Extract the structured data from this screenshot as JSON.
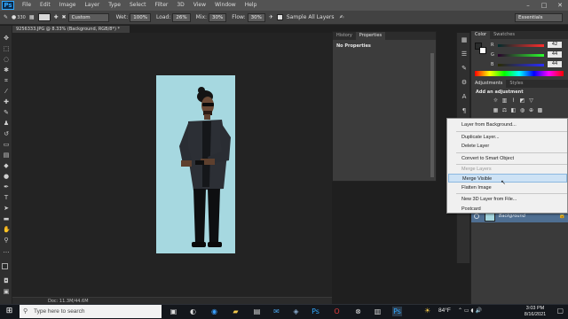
{
  "menubar": {
    "logo": "Ps",
    "items": [
      "File",
      "Edit",
      "Image",
      "Layer",
      "Type",
      "Select",
      "Filter",
      "3D",
      "View",
      "Window",
      "Help"
    ],
    "window_controls": [
      "–",
      "□",
      "✕"
    ]
  },
  "optionsbar": {
    "brush_size": "330",
    "mode_value": "Custom",
    "wet_label": "Wet:",
    "wet_value": "100%",
    "load_label": "Load:",
    "load_value": "26%",
    "mix_label": "Mix:",
    "mix_value": "30%",
    "flow_label": "Flow:",
    "flow_value": "30%",
    "sample_label": "Sample All Layers",
    "workspace": "Essentials"
  },
  "document": {
    "tab_title": "9256333.JPG @ 8.33% (Background, RGB/8*) *",
    "status": "Doc: 11.3M/44.6M"
  },
  "properties_panel": {
    "tabs": [
      "History",
      "Properties"
    ],
    "active_tab": "Properties",
    "message": "No Properties"
  },
  "color_panel": {
    "tabs": [
      "Color",
      "Swatches"
    ],
    "rows": [
      {
        "label": "R",
        "value": "42"
      },
      {
        "label": "G",
        "value": "44"
      },
      {
        "label": "B",
        "value": "44"
      }
    ]
  },
  "adjustments_panel": {
    "tabs": [
      "Adjustments",
      "Styles"
    ],
    "heading": "Add an adjustment"
  },
  "layers_panel": {
    "selected_layer": "Background"
  },
  "context_menu": {
    "items": [
      {
        "label": "Layer from Background...",
        "disabled": false,
        "hover": false
      },
      {
        "label": "Duplicate Layer...",
        "disabled": false,
        "hover": false
      },
      {
        "label": "Delete Layer",
        "disabled": false,
        "hover": false
      },
      {
        "label": "Convert to Smart Object",
        "disabled": false,
        "hover": false
      },
      {
        "label": "Merge Layers",
        "disabled": true,
        "hover": false
      },
      {
        "label": "Merge Visible",
        "disabled": false,
        "hover": true
      },
      {
        "label": "Flatten Image",
        "disabled": false,
        "hover": false
      },
      {
        "label": "New 3D Layer from File...",
        "disabled": false,
        "hover": false
      },
      {
        "label": "Postcard",
        "disabled": false,
        "hover": false
      }
    ]
  },
  "taskbar": {
    "search_placeholder": "Type here to search",
    "weather": "84°F",
    "time": "3:03 PM",
    "date": "8/16/2021"
  },
  "colors": {
    "canvas_bg": "#a6d8e0",
    "ps_blue": "#31a8ff",
    "menu_hover": "#cde2f5",
    "layer_selected": "#4f6f92"
  }
}
